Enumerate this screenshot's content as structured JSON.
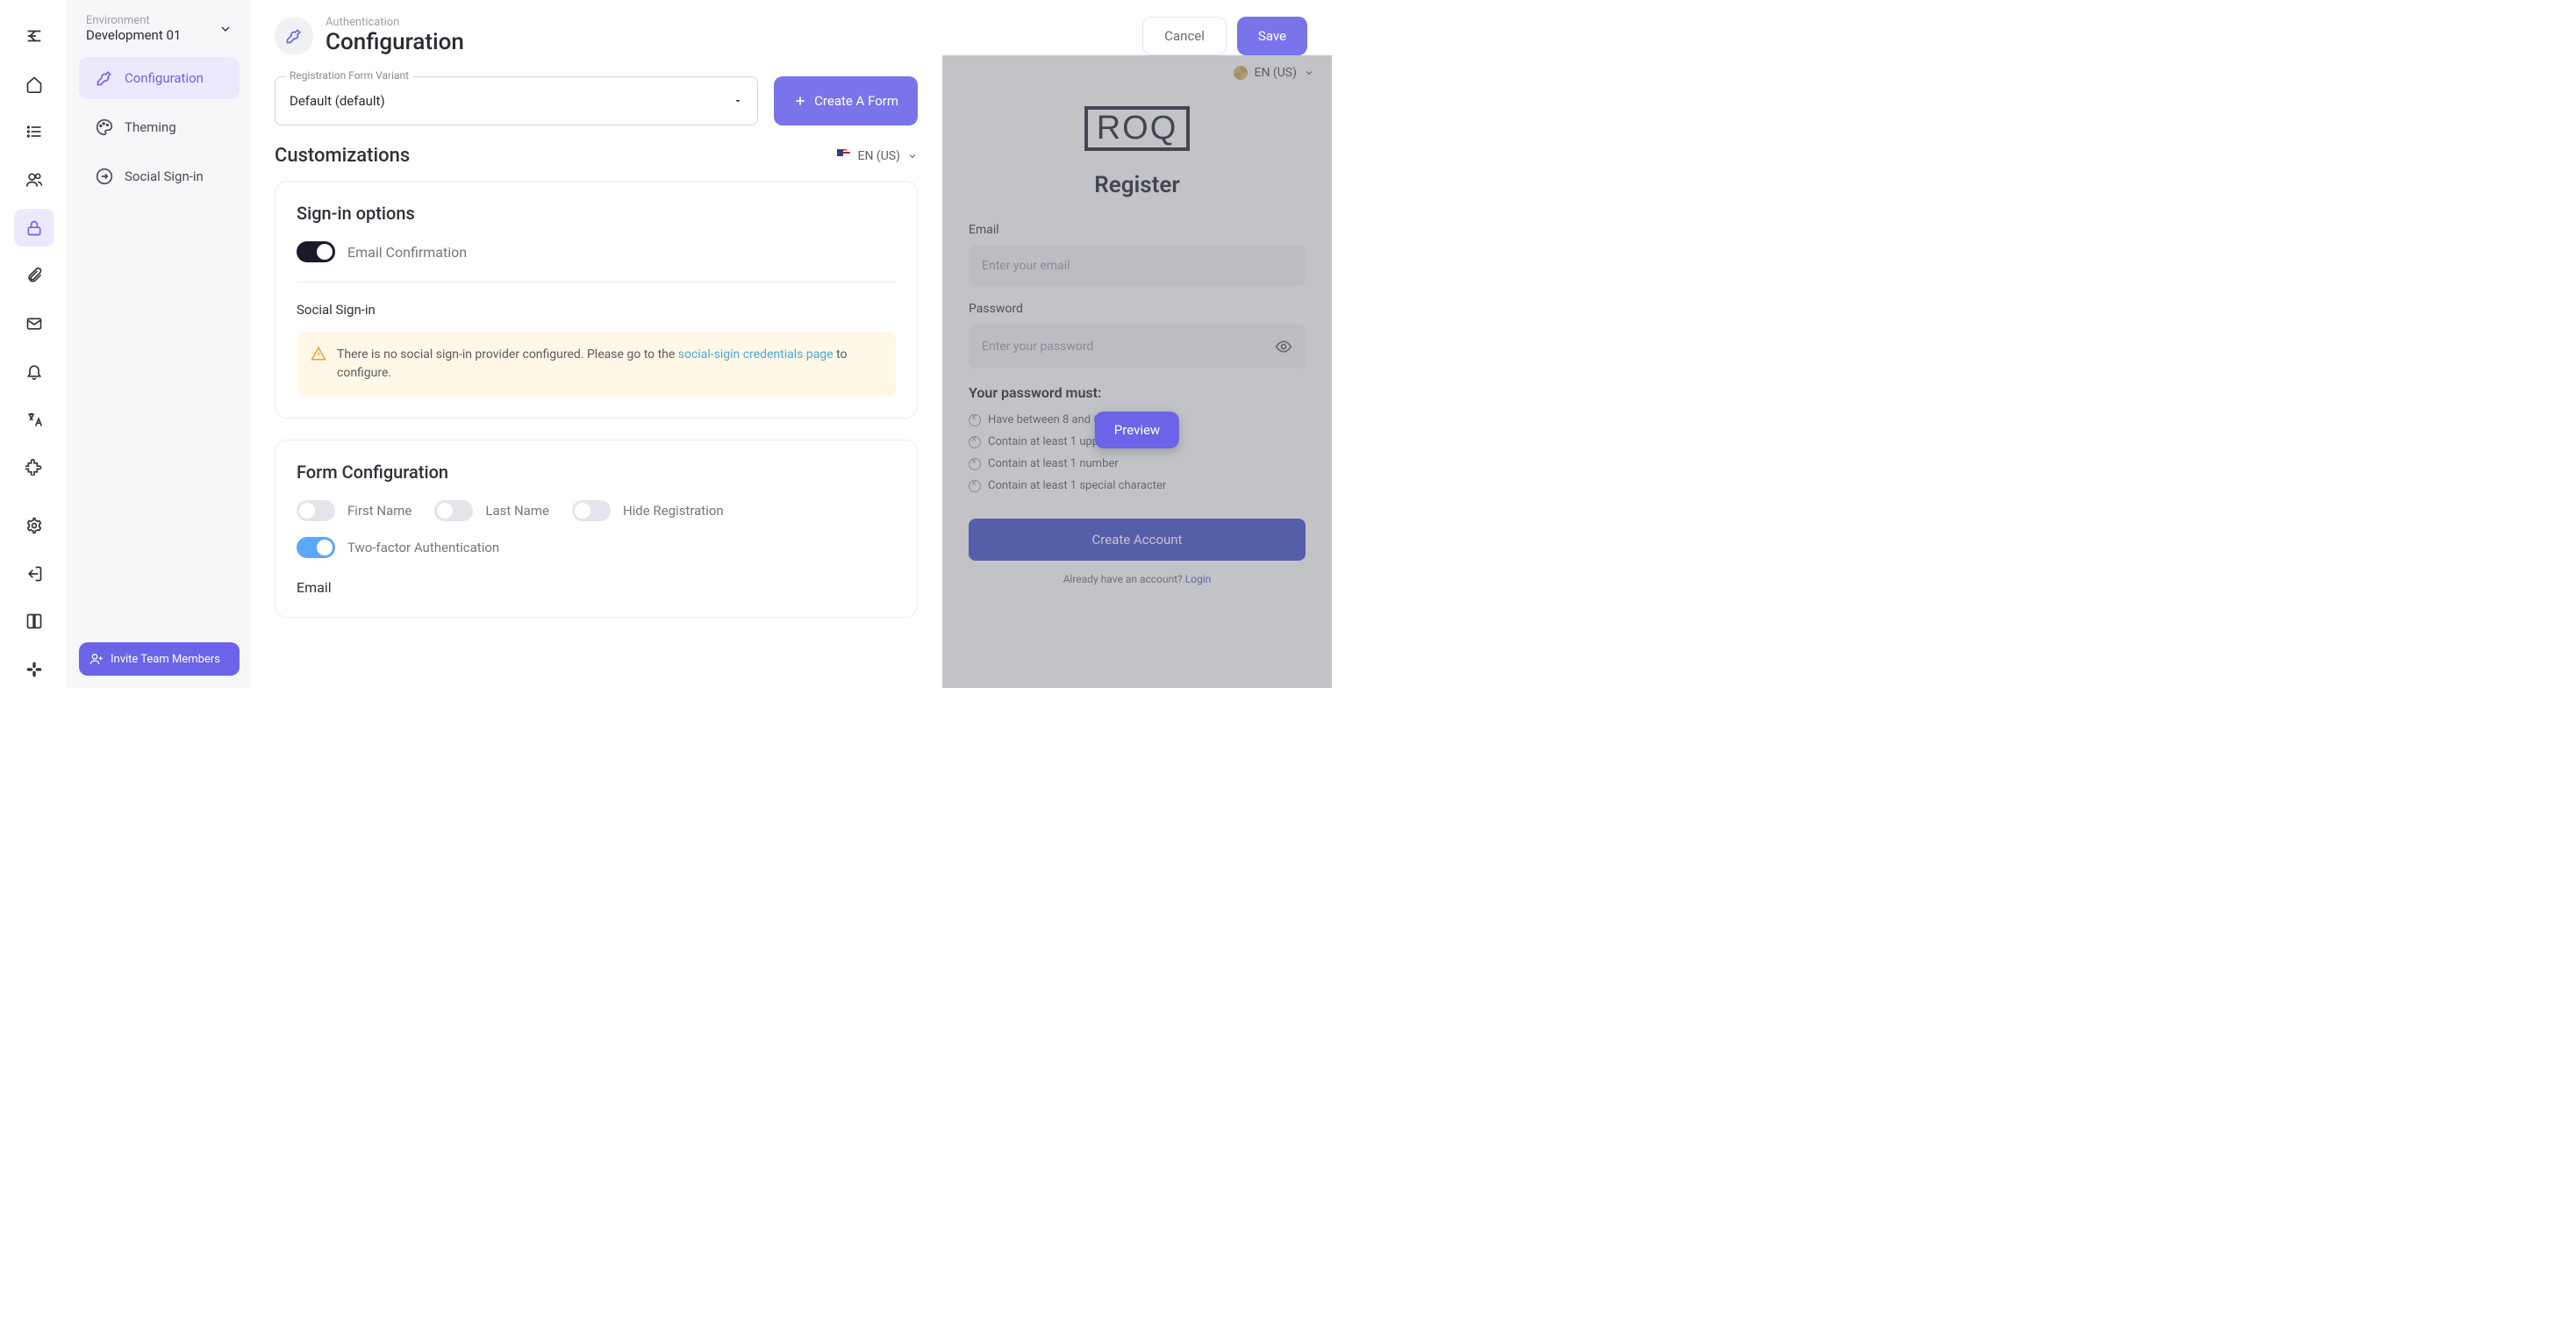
{
  "env": {
    "label": "Environment",
    "name": "Development 01"
  },
  "iconbar": [
    "menu",
    "home",
    "list",
    "users",
    "lock",
    "attach",
    "mail",
    "bell",
    "translate",
    "puzzle",
    "settings",
    "logout",
    "book",
    "slack"
  ],
  "sidebar": {
    "items": [
      {
        "label": "Configuration"
      },
      {
        "label": "Theming"
      },
      {
        "label": "Social Sign-in"
      }
    ],
    "invite": "Invite Team Members"
  },
  "header": {
    "crumb": "Authentication",
    "title": "Configuration",
    "cancel": "Cancel",
    "save": "Save"
  },
  "form": {
    "variant_label": "Registration Form Variant",
    "variant_value": "Default (default)",
    "create_button": "Create A Form"
  },
  "customizations": {
    "title": "Customizations",
    "locale": "EN (US)"
  },
  "signin": {
    "title": "Sign-in options",
    "email_confirmation": "Email Confirmation",
    "social_title": "Social Sign-in",
    "alert_pre": "There is no social sign-in provider configured. Please go to the ",
    "alert_link": "social-sigin credentials page",
    "alert_post": " to configure."
  },
  "formconfig": {
    "title": "Form Configuration",
    "first_name": "First Name",
    "last_name": "Last Name",
    "hide_reg": "Hide Registration",
    "twofa": "Two-factor Authentication",
    "email": "Email"
  },
  "preview": {
    "button": "Preview",
    "locale": "EN (US)",
    "logo": "ROQ",
    "heading": "Register",
    "email_label": "Email",
    "email_ph": "Enter your email",
    "pw_label": "Password",
    "pw_ph": "Enter your password",
    "pw_must": "Your password must:",
    "rules": [
      "Have between 8 and 64 characters",
      "Contain at least 1 upper-case letter",
      "Contain at least 1 number",
      "Contain at least 1 special character"
    ],
    "submit": "Create Account",
    "foot_pre": "Already have an account? ",
    "foot_link": "Login"
  }
}
